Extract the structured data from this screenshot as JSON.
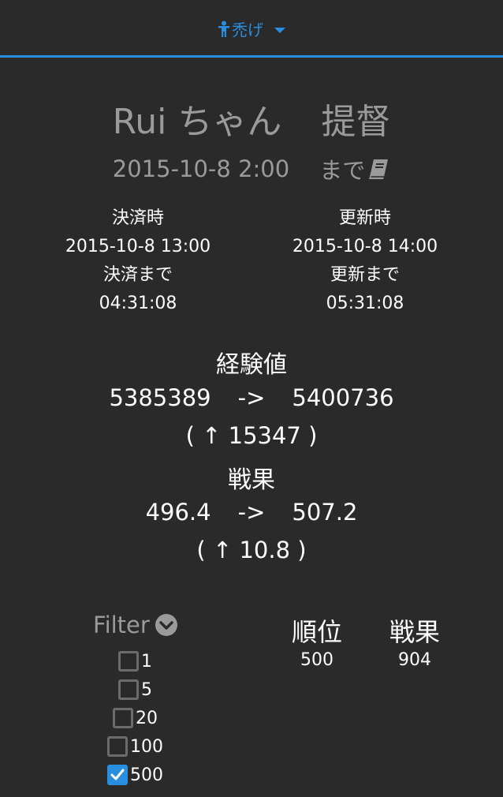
{
  "nav": {
    "label": "禿げ",
    "icon": "person-icon",
    "accent": "#2a8ee0"
  },
  "header": {
    "name": "Rui ちゃん",
    "rank_title": "提督",
    "deadline_date": "2015-10-8 2:00",
    "deadline_suffix": "まで",
    "deadline_icon": "book-icon"
  },
  "settlement": {
    "label": "決済時",
    "time": "2015-10-8 13:00",
    "until_label": "決済まで",
    "countdown": "04:31:08"
  },
  "update": {
    "label": "更新時",
    "time": "2015-10-8 14:00",
    "until_label": "更新まで",
    "countdown": "05:31:08"
  },
  "experience": {
    "label": "経験値",
    "from": "5385389",
    "arrow": "->",
    "to": "5400736",
    "delta": "( ↑ 15347 )"
  },
  "senka": {
    "label": "戦果",
    "from": "496.4",
    "arrow": "->",
    "to": "507.2",
    "delta": "( ↑ 10.8 )"
  },
  "filter": {
    "label": "Filter",
    "options": [
      {
        "label": "1",
        "checked": false
      },
      {
        "label": "5",
        "checked": false
      },
      {
        "label": "20",
        "checked": false
      },
      {
        "label": "100",
        "checked": false
      },
      {
        "label": "500",
        "checked": true
      }
    ]
  },
  "ranking": {
    "rank_header": "順位",
    "senka_header": "戦果",
    "rank_value": "500",
    "senka_value": "904"
  }
}
